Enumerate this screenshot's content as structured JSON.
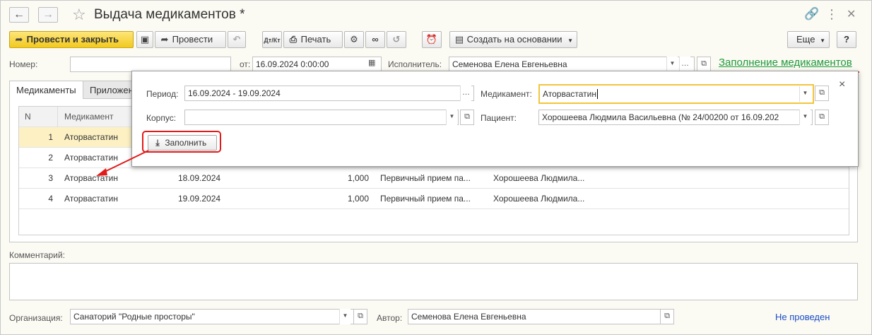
{
  "window": {
    "title": "Выдача медикаментов *",
    "star_icon": "☆"
  },
  "toolbar": {
    "post_close_label": "Провести и закрыть",
    "post_label": "Провести",
    "print_label": "Печать",
    "create_based_label": "Создать на основании",
    "more_label": "Еще",
    "help_label": "?"
  },
  "header": {
    "number_label": "Номер:",
    "number_value": "",
    "date_label": "от:",
    "date_value": "16.09.2024  0:00:00",
    "executor_label": "Исполнитель:",
    "executor_value": "Семенова Елена Евгеньевна",
    "fill_link": "Заполнение медикаментов"
  },
  "tabs": [
    {
      "label": "Медикаменты"
    },
    {
      "label": "Приложен"
    }
  ],
  "table": {
    "columns": [
      "N",
      "Медикамент"
    ],
    "rows": [
      {
        "n": "1",
        "drug": "Аторвастатин",
        "date": "",
        "qty": "",
        "type": "",
        "patient": ""
      },
      {
        "n": "2",
        "drug": "Аторвастатин",
        "date": "",
        "qty": "",
        "type": "",
        "patient": ""
      },
      {
        "n": "3",
        "drug": "Аторвастатин",
        "date": "18.09.2024",
        "qty": "1,000",
        "type": "Первичный прием па...",
        "patient": "Хорошеева Людмила..."
      },
      {
        "n": "4",
        "drug": "Аторвастатин",
        "date": "19.09.2024",
        "qty": "1,000",
        "type": "Первичный прием па...",
        "patient": "Хорошеева Людмила..."
      }
    ]
  },
  "popup": {
    "period_label": "Период:",
    "period_value": "16.09.2024 - 19.09.2024",
    "corpus_label": "Корпус:",
    "corpus_value": "",
    "drug_label": "Медикамент:",
    "drug_value": "Аторвастатин",
    "patient_label": "Пациент:",
    "patient_value": "Хорошеева Людмила Васильевна (№ 24/00200 от 16.09.202",
    "fill_button": "Заполнить",
    "close": "×"
  },
  "footer": {
    "comment_label": "Комментарий:",
    "comment_value": "",
    "org_label": "Организация:",
    "org_value": "Санаторий \"Родные просторы\"",
    "author_label": "Автор:",
    "author_value": "Семенова Елена Евгеньевна",
    "status": "Не проведен"
  },
  "colors": {
    "primary_button": "#f2c91e",
    "link": "#1f9a3c",
    "annotation": "#e31a1a",
    "status": "#1d4fc9",
    "selected_row": "#fdf1c4"
  }
}
